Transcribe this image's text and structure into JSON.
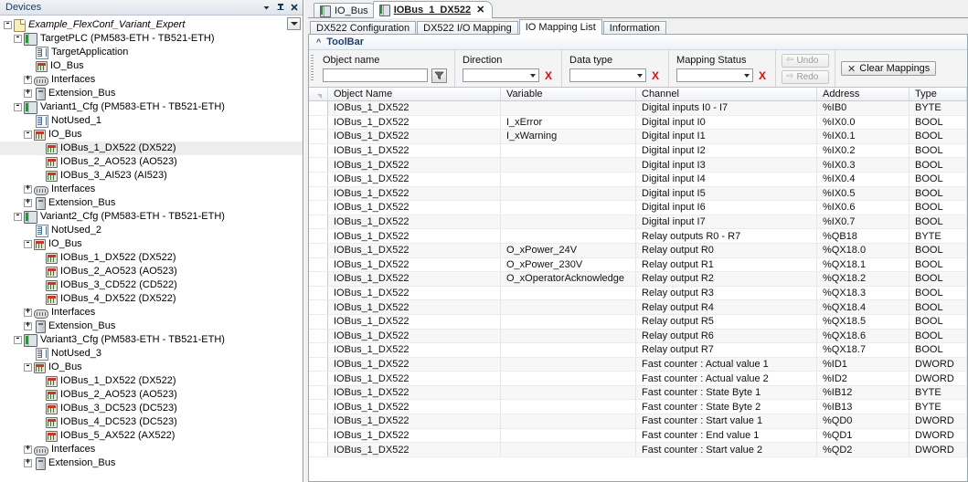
{
  "devices_panel": {
    "title": "Devices",
    "header_buttons": [
      {
        "name": "dropdown-menu-icon",
        "glyph": "▾"
      },
      {
        "name": "auto-hide-pin-icon",
        "glyph": "⚲"
      },
      {
        "name": "close-icon",
        "glyph": "✕"
      }
    ],
    "tree": [
      {
        "depth": 0,
        "expander": "-",
        "icon": "project",
        "label": "Example_FlexConf_Variant_Expert",
        "italic": true,
        "selected": false
      },
      {
        "depth": 1,
        "expander": "-",
        "icon": "plc",
        "label": "TargetPLC (PM583-ETH - TB521-ETH)",
        "italic": false,
        "selected": false
      },
      {
        "depth": 2,
        "expander": "",
        "icon": "application",
        "label": "TargetApplication",
        "italic": false,
        "selected": false
      },
      {
        "depth": 2,
        "expander": "",
        "icon": "module",
        "label": "IO_Bus",
        "italic": false,
        "selected": false
      },
      {
        "depth": 2,
        "expander": "+",
        "icon": "interfaces",
        "label": "Interfaces",
        "italic": false,
        "selected": false
      },
      {
        "depth": 2,
        "expander": "+",
        "icon": "extension",
        "label": "Extension_Bus",
        "italic": false,
        "selected": false
      },
      {
        "depth": 1,
        "expander": "-",
        "icon": "plc",
        "label": "Variant1_Cfg (PM583-ETH - TB521-ETH)",
        "italic": false,
        "selected": false
      },
      {
        "depth": 2,
        "expander": "",
        "icon": "application",
        "label": "NotUsed_1",
        "italic": false,
        "selected": false
      },
      {
        "depth": 2,
        "expander": "-",
        "icon": "module",
        "label": "IO_Bus",
        "italic": false,
        "selected": false
      },
      {
        "depth": 3,
        "expander": "",
        "icon": "module",
        "label": "IOBus_1_DX522 (DX522)",
        "italic": false,
        "selected": true
      },
      {
        "depth": 3,
        "expander": "",
        "icon": "module",
        "label": "IOBus_2_AO523 (AO523)",
        "italic": false,
        "selected": false
      },
      {
        "depth": 3,
        "expander": "",
        "icon": "module",
        "label": "IOBus_3_AI523 (AI523)",
        "italic": false,
        "selected": false
      },
      {
        "depth": 2,
        "expander": "+",
        "icon": "interfaces",
        "label": "Interfaces",
        "italic": false,
        "selected": false
      },
      {
        "depth": 2,
        "expander": "+",
        "icon": "extension",
        "label": "Extension_Bus",
        "italic": false,
        "selected": false
      },
      {
        "depth": 1,
        "expander": "-",
        "icon": "plc",
        "label": "Variant2_Cfg (PM583-ETH - TB521-ETH)",
        "italic": false,
        "selected": false
      },
      {
        "depth": 2,
        "expander": "",
        "icon": "application",
        "label": "NotUsed_2",
        "italic": false,
        "selected": false
      },
      {
        "depth": 2,
        "expander": "-",
        "icon": "module",
        "label": "IO_Bus",
        "italic": false,
        "selected": false
      },
      {
        "depth": 3,
        "expander": "",
        "icon": "module",
        "label": "IOBus_1_DX522 (DX522)",
        "italic": false,
        "selected": false
      },
      {
        "depth": 3,
        "expander": "",
        "icon": "module",
        "label": "IOBus_2_AO523 (AO523)",
        "italic": false,
        "selected": false
      },
      {
        "depth": 3,
        "expander": "",
        "icon": "module",
        "label": "IOBus_3_CD522 (CD522)",
        "italic": false,
        "selected": false
      },
      {
        "depth": 3,
        "expander": "",
        "icon": "module",
        "label": "IOBus_4_DX522 (DX522)",
        "italic": false,
        "selected": false
      },
      {
        "depth": 2,
        "expander": "+",
        "icon": "interfaces",
        "label": "Interfaces",
        "italic": false,
        "selected": false
      },
      {
        "depth": 2,
        "expander": "+",
        "icon": "extension",
        "label": "Extension_Bus",
        "italic": false,
        "selected": false
      },
      {
        "depth": 1,
        "expander": "-",
        "icon": "plc",
        "label": "Variant3_Cfg (PM583-ETH - TB521-ETH)",
        "italic": false,
        "selected": false
      },
      {
        "depth": 2,
        "expander": "",
        "icon": "application",
        "label": "NotUsed_3",
        "italic": false,
        "selected": false
      },
      {
        "depth": 2,
        "expander": "-",
        "icon": "module",
        "label": "IO_Bus",
        "italic": false,
        "selected": false
      },
      {
        "depth": 3,
        "expander": "",
        "icon": "module",
        "label": "IOBus_1_DX522 (DX522)",
        "italic": false,
        "selected": false
      },
      {
        "depth": 3,
        "expander": "",
        "icon": "module",
        "label": "IOBus_2_AO523 (AO523)",
        "italic": false,
        "selected": false
      },
      {
        "depth": 3,
        "expander": "",
        "icon": "module",
        "label": "IOBus_3_DC523 (DC523)",
        "italic": false,
        "selected": false
      },
      {
        "depth": 3,
        "expander": "",
        "icon": "module",
        "label": "IOBus_4_DC523 (DC523)",
        "italic": false,
        "selected": false
      },
      {
        "depth": 3,
        "expander": "",
        "icon": "module",
        "label": "IOBus_5_AX522 (AX522)",
        "italic": false,
        "selected": false
      },
      {
        "depth": 2,
        "expander": "+",
        "icon": "interfaces",
        "label": "Interfaces",
        "italic": false,
        "selected": false
      },
      {
        "depth": 2,
        "expander": "+",
        "icon": "extension",
        "label": "Extension_Bus",
        "italic": false,
        "selected": false
      }
    ]
  },
  "editor": {
    "document_tabs": [
      {
        "label": "IO_Bus",
        "active": false,
        "closable": false
      },
      {
        "label": "IOBus_1_DX522",
        "active": true,
        "closable": true,
        "close_glyph": "✕"
      }
    ],
    "sub_tabs": [
      {
        "label": "DX522 Configuration",
        "active": false
      },
      {
        "label": "DX522 I/O Mapping",
        "active": false
      },
      {
        "label": "IO Mapping List",
        "active": true
      },
      {
        "label": "Information",
        "active": false
      }
    ],
    "toolbar_section": {
      "caret": "^",
      "title": "ToolBar"
    },
    "filters": [
      {
        "label": "Object name",
        "type": "text",
        "value": "",
        "button_icon": "filter-funnel-icon"
      },
      {
        "label": "Direction",
        "type": "select",
        "value": "",
        "clear_glyph": "X"
      },
      {
        "label": "Data type",
        "type": "select",
        "value": "",
        "clear_glyph": "X"
      },
      {
        "label": "Mapping Status",
        "type": "select",
        "value": "",
        "clear_glyph": "X"
      }
    ],
    "undo_redo": [
      {
        "label": "Undo",
        "glyph": "⇦",
        "enabled": false
      },
      {
        "label": "Redo",
        "glyph": "⇨",
        "enabled": false
      }
    ],
    "clear_mappings": {
      "label": "Clear Mappings",
      "glyph": "✕"
    },
    "grid": {
      "columns": [
        "Object Name",
        "Variable",
        "Channel",
        "Address",
        "Type"
      ],
      "rows": [
        {
          "object": "IOBus_1_DX522",
          "variable": "",
          "channel": "Digital inputs I0 - I7",
          "address": "%IB0",
          "type": "BYTE"
        },
        {
          "object": "IOBus_1_DX522",
          "variable": "I_xError",
          "channel": "Digital input I0",
          "address": "%IX0.0",
          "type": "BOOL"
        },
        {
          "object": "IOBus_1_DX522",
          "variable": "I_xWarning",
          "channel": "Digital input I1",
          "address": "%IX0.1",
          "type": "BOOL"
        },
        {
          "object": "IOBus_1_DX522",
          "variable": "",
          "channel": "Digital input I2",
          "address": "%IX0.2",
          "type": "BOOL"
        },
        {
          "object": "IOBus_1_DX522",
          "variable": "",
          "channel": "Digital input I3",
          "address": "%IX0.3",
          "type": "BOOL"
        },
        {
          "object": "IOBus_1_DX522",
          "variable": "",
          "channel": "Digital input I4",
          "address": "%IX0.4",
          "type": "BOOL"
        },
        {
          "object": "IOBus_1_DX522",
          "variable": "",
          "channel": "Digital input I5",
          "address": "%IX0.5",
          "type": "BOOL"
        },
        {
          "object": "IOBus_1_DX522",
          "variable": "",
          "channel": "Digital input I6",
          "address": "%IX0.6",
          "type": "BOOL"
        },
        {
          "object": "IOBus_1_DX522",
          "variable": "",
          "channel": "Digital input I7",
          "address": "%IX0.7",
          "type": "BOOL"
        },
        {
          "object": "IOBus_1_DX522",
          "variable": "",
          "channel": "Relay outputs R0 - R7",
          "address": "%QB18",
          "type": "BYTE"
        },
        {
          "object": "IOBus_1_DX522",
          "variable": "O_xPower_24V",
          "channel": "Relay output R0",
          "address": "%QX18.0",
          "type": "BOOL"
        },
        {
          "object": "IOBus_1_DX522",
          "variable": "O_xPower_230V",
          "channel": "Relay output R1",
          "address": "%QX18.1",
          "type": "BOOL"
        },
        {
          "object": "IOBus_1_DX522",
          "variable": "O_xOperatorAcknowledge",
          "channel": "Relay output R2",
          "address": "%QX18.2",
          "type": "BOOL"
        },
        {
          "object": "IOBus_1_DX522",
          "variable": "",
          "channel": "Relay output R3",
          "address": "%QX18.3",
          "type": "BOOL"
        },
        {
          "object": "IOBus_1_DX522",
          "variable": "",
          "channel": "Relay output R4",
          "address": "%QX18.4",
          "type": "BOOL"
        },
        {
          "object": "IOBus_1_DX522",
          "variable": "",
          "channel": "Relay output R5",
          "address": "%QX18.5",
          "type": "BOOL"
        },
        {
          "object": "IOBus_1_DX522",
          "variable": "",
          "channel": "Relay output R6",
          "address": "%QX18.6",
          "type": "BOOL"
        },
        {
          "object": "IOBus_1_DX522",
          "variable": "",
          "channel": "Relay output R7",
          "address": "%QX18.7",
          "type": "BOOL"
        },
        {
          "object": "IOBus_1_DX522",
          "variable": "",
          "channel": "Fast counter : Actual value 1",
          "address": "%ID1",
          "type": "DWORD"
        },
        {
          "object": "IOBus_1_DX522",
          "variable": "",
          "channel": "Fast counter : Actual value 2",
          "address": "%ID2",
          "type": "DWORD"
        },
        {
          "object": "IOBus_1_DX522",
          "variable": "",
          "channel": "Fast counter : State Byte 1",
          "address": "%IB12",
          "type": "BYTE"
        },
        {
          "object": "IOBus_1_DX522",
          "variable": "",
          "channel": "Fast counter : State Byte 2",
          "address": "%IB13",
          "type": "BYTE"
        },
        {
          "object": "IOBus_1_DX522",
          "variable": "",
          "channel": "Fast counter : Start value 1",
          "address": "%QD0",
          "type": "DWORD"
        },
        {
          "object": "IOBus_1_DX522",
          "variable": "",
          "channel": "Fast counter : End value 1",
          "address": "%QD1",
          "type": "DWORD"
        },
        {
          "object": "IOBus_1_DX522",
          "variable": "",
          "channel": "Fast counter : Start value 2",
          "address": "%QD2",
          "type": "DWORD"
        }
      ]
    }
  }
}
